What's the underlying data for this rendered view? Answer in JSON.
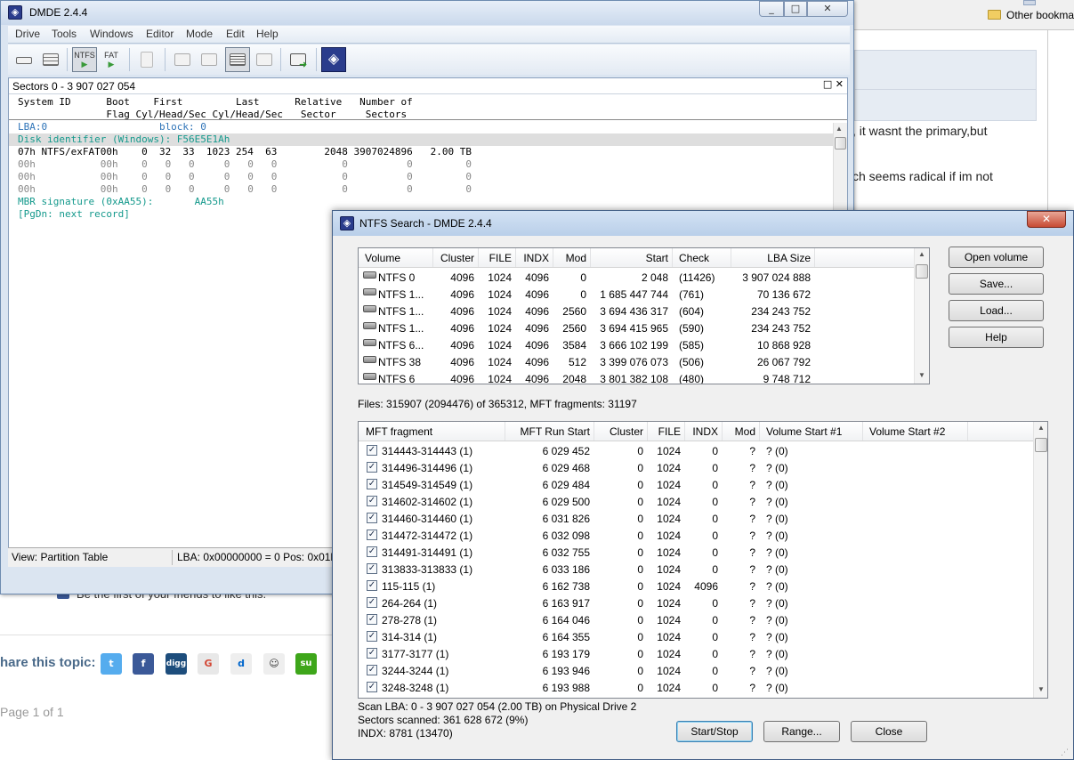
{
  "browser": {
    "bookmarks_label": "Other bookma",
    "snippet_lines": [
      ", it wasnt the primary,but",
      "ch seems radical if im not"
    ],
    "facebook_like": "Be the first of your friends to like this.",
    "share_label": "hare this topic:",
    "share_icons": [
      "twitter-icon",
      "facebook-icon",
      "digg-icon",
      "google-icon",
      "delicious-icon",
      "reddit-icon",
      "stumbleupon-icon"
    ],
    "share_icon_glyphs": [
      "t",
      "f",
      "digg",
      "G",
      "d",
      "☺",
      "su"
    ],
    "page_label": "Page 1 of 1"
  },
  "dmde": {
    "title": "DMDE 2.4.4",
    "menu": [
      "Drive",
      "Tools",
      "Windows",
      "Editor",
      "Mode",
      "Edit",
      "Help"
    ],
    "toolbar_labels": {
      "ntfs": "NTFS",
      "fat": "FAT"
    },
    "sectors_title": "Sectors 0 - 3 907 027 054",
    "pane_buttons": "□ ✕",
    "hex_lines": [
      "System ID      Boot    First         Last      Relative   Number of",
      "               Flag Cyl/Head/Sec Cyl/Head/Sec   Sector     Sectors",
      "LBA:0                   block: 0",
      "Disk identifier (Windows): F56E5E1Ah",
      "07h NTFS/exFAT00h    0  32  33  1023 254  63        2048 3907024896   2.00 TB",
      "00h           00h    0   0   0     0   0   0           0          0         0",
      "00h           00h    0   0   0     0   0   0           0          0         0",
      "00h           00h    0   0   0     0   0   0           0          0         0",
      "MBR signature (0xAA55):       AA55h",
      "[PgDn: next record]"
    ],
    "status_view": "View: Partition Table",
    "status_lba": "LBA: 0x00000000 = 0  Pos: 0x01b8"
  },
  "ntfs_search": {
    "title": "NTFS Search - DMDE 2.4.4",
    "volume_columns": [
      "Volume",
      "Cluster",
      "FILE",
      "INDX",
      "Mod",
      "Start",
      "Check",
      "LBA Size"
    ],
    "volumes": [
      [
        "NTFS 0",
        "4096",
        "1024",
        "4096",
        "0",
        "2 048",
        "(11426)",
        "3 907 024 888"
      ],
      [
        "NTFS 1...",
        "4096",
        "1024",
        "4096",
        "0",
        "1 685 447 744",
        "(761)",
        "70 136 672"
      ],
      [
        "NTFS 1...",
        "4096",
        "1024",
        "4096",
        "2560",
        "3 694 436 317",
        "(604)",
        "234 243 752"
      ],
      [
        "NTFS 1...",
        "4096",
        "1024",
        "4096",
        "2560",
        "3 694 415 965",
        "(590)",
        "234 243 752"
      ],
      [
        "NTFS 6...",
        "4096",
        "1024",
        "4096",
        "3584",
        "3 666 102 199",
        "(585)",
        "10 868 928"
      ],
      [
        "NTFS 38",
        "4096",
        "1024",
        "4096",
        "512",
        "3 399 076 073",
        "(506)",
        "26 067 792"
      ],
      [
        "NTFS 6",
        "4096",
        "1024",
        "4096",
        "2048",
        "3 801 382 108",
        "(480)",
        "9 748 712"
      ]
    ],
    "buttons": {
      "open_volume": "Open volume",
      "save": "Save...",
      "load": "Load...",
      "help": "Help"
    },
    "files_summary": "Files: 315907 (2094476) of 365312, MFT fragments: 31197",
    "fragment_columns": [
      "MFT fragment",
      "MFT Run Start",
      "Cluster",
      "FILE",
      "INDX",
      "Mod",
      "Volume Start #1",
      "Volume Start #2"
    ],
    "fragments": [
      [
        "314443-314443 (1)",
        "6 029 452",
        "0",
        "1024",
        "0",
        "?",
        "? (0)"
      ],
      [
        "314496-314496 (1)",
        "6 029 468",
        "0",
        "1024",
        "0",
        "?",
        "? (0)"
      ],
      [
        "314549-314549 (1)",
        "6 029 484",
        "0",
        "1024",
        "0",
        "?",
        "? (0)"
      ],
      [
        "314602-314602 (1)",
        "6 029 500",
        "0",
        "1024",
        "0",
        "?",
        "? (0)"
      ],
      [
        "314460-314460 (1)",
        "6 031 826",
        "0",
        "1024",
        "0",
        "?",
        "? (0)"
      ],
      [
        "314472-314472 (1)",
        "6 032 098",
        "0",
        "1024",
        "0",
        "?",
        "? (0)"
      ],
      [
        "314491-314491 (1)",
        "6 032 755",
        "0",
        "1024",
        "0",
        "?",
        "? (0)"
      ],
      [
        "313833-313833 (1)",
        "6 033 186",
        "0",
        "1024",
        "0",
        "?",
        "? (0)"
      ],
      [
        "115-115 (1)",
        "6 162 738",
        "0",
        "1024",
        "4096",
        "?",
        "? (0)"
      ],
      [
        "264-264 (1)",
        "6 163 917",
        "0",
        "1024",
        "0",
        "?",
        "? (0)"
      ],
      [
        "278-278 (1)",
        "6 164 046",
        "0",
        "1024",
        "0",
        "?",
        "? (0)"
      ],
      [
        "314-314 (1)",
        "6 164 355",
        "0",
        "1024",
        "0",
        "?",
        "? (0)"
      ],
      [
        "3177-3177 (1)",
        "6 193 179",
        "0",
        "1024",
        "0",
        "?",
        "? (0)"
      ],
      [
        "3244-3244 (1)",
        "6 193 946",
        "0",
        "1024",
        "0",
        "?",
        "? (0)"
      ],
      [
        "3248-3248 (1)",
        "6 193 988",
        "0",
        "1024",
        "0",
        "?",
        "? (0)"
      ]
    ],
    "scan_info": [
      "Scan LBA: 0 - 3 907 027 054 (2.00 TB) on Physical Drive 2",
      "Sectors scanned: 361 628 672 (9%)",
      "INDX: 8781 (13470)"
    ],
    "bottom_buttons": {
      "start_stop": "Start/Stop",
      "range": "Range...",
      "close": "Close"
    }
  },
  "colors": {
    "title_bar": "#c8d8ec",
    "hex_blue": "#2f74b8",
    "hex_green": "#14998c",
    "highlight_row": "#dedede"
  }
}
